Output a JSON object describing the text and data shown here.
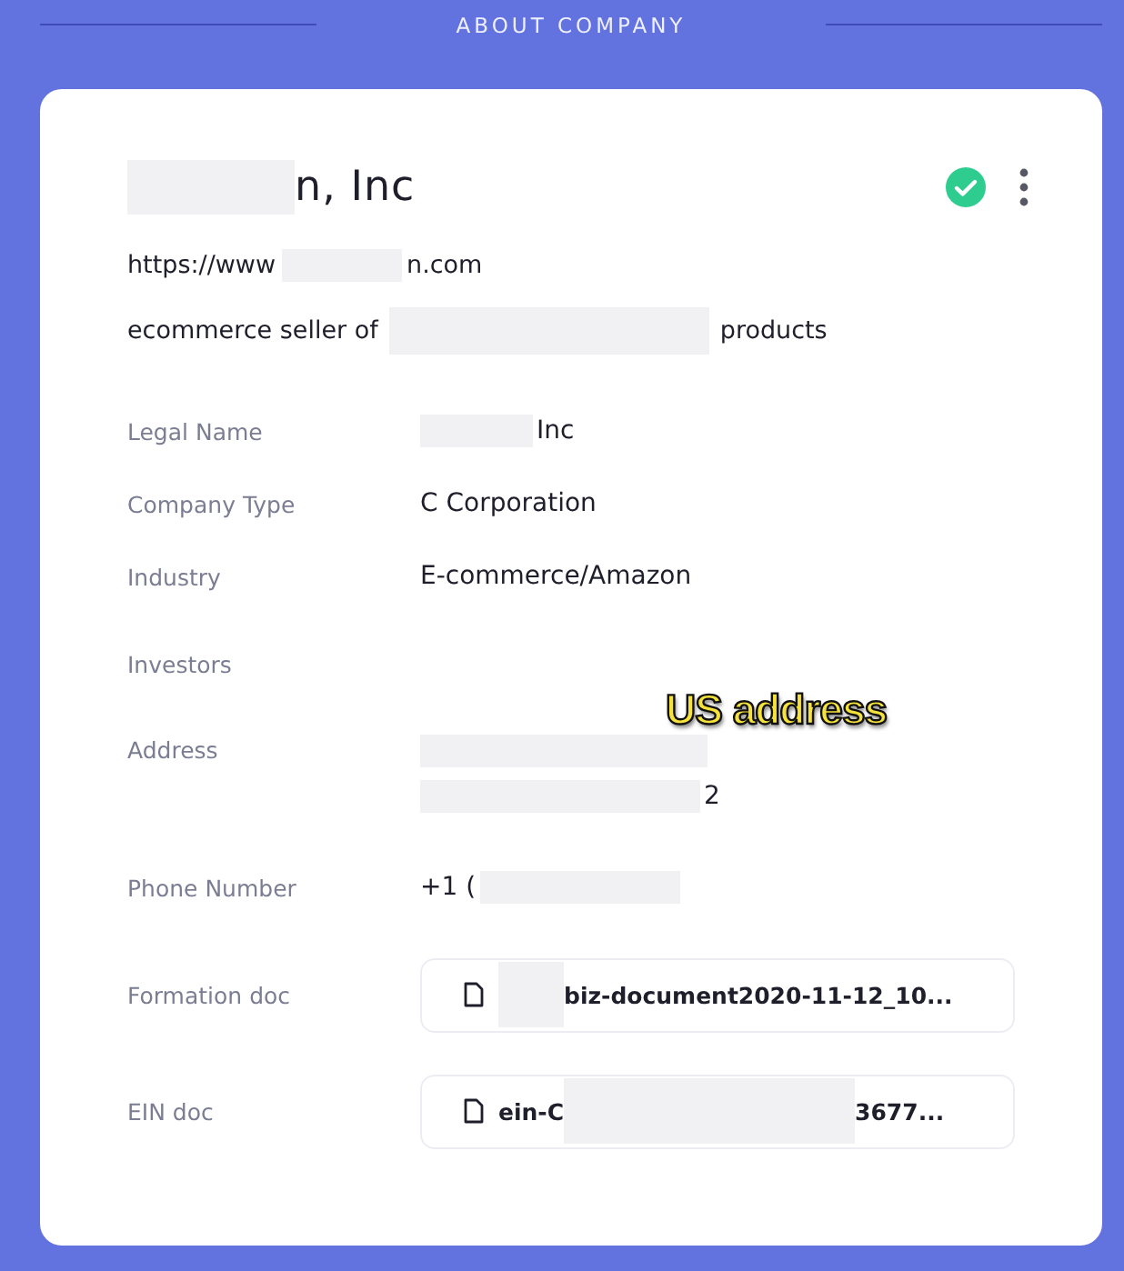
{
  "section_title": "ABOUT COMPANY",
  "company": {
    "name": [
      {
        "kind": "redacted"
      },
      {
        "kind": "text",
        "text": "n, Inc"
      }
    ],
    "verified": true,
    "website": [
      {
        "kind": "text",
        "text": "https://www"
      },
      {
        "kind": "redacted"
      },
      {
        "kind": "text",
        "text": "n.com"
      }
    ],
    "description": [
      {
        "kind": "text",
        "text": "ecommerce seller of"
      },
      {
        "kind": "redacted"
      },
      {
        "kind": "text",
        "text": "products"
      }
    ]
  },
  "fields": [
    {
      "label": "Legal Name",
      "kind": "text",
      "lines": [
        [
          {
            "kind": "redacted"
          },
          {
            "kind": "text",
            "text": "Inc"
          }
        ]
      ]
    },
    {
      "label": "Company Type",
      "kind": "text",
      "lines": [
        [
          {
            "kind": "text",
            "text": "C Corporation"
          }
        ]
      ]
    },
    {
      "label": "Industry",
      "kind": "text",
      "lines": [
        [
          {
            "kind": "text",
            "text": "E-commerce/Amazon"
          }
        ]
      ]
    },
    {
      "label": "Investors"
    },
    {
      "label": "Address",
      "kind": "text",
      "lines": [
        [
          {
            "kind": "redacted"
          }
        ],
        [
          {
            "kind": "redacted"
          },
          {
            "kind": "text",
            "text": "2"
          }
        ]
      ]
    },
    {
      "label": "Phone Number",
      "kind": "text",
      "lines": [
        [
          {
            "kind": "text",
            "text": "+1 ("
          },
          {
            "kind": "redacted"
          }
        ]
      ]
    },
    {
      "label": "Formation doc",
      "kind": "file",
      "lines": [
        [
          {
            "kind": "redacted"
          },
          {
            "kind": "text",
            "text": "biz-document2020-11-12_10..."
          }
        ]
      ]
    },
    {
      "label": "EIN doc",
      "kind": "file",
      "lines": [
        [
          {
            "kind": "text",
            "text": "ein-C"
          },
          {
            "kind": "redacted"
          },
          {
            "kind": "text",
            "text": "3677..."
          }
        ]
      ]
    }
  ],
  "annotation": "US address"
}
